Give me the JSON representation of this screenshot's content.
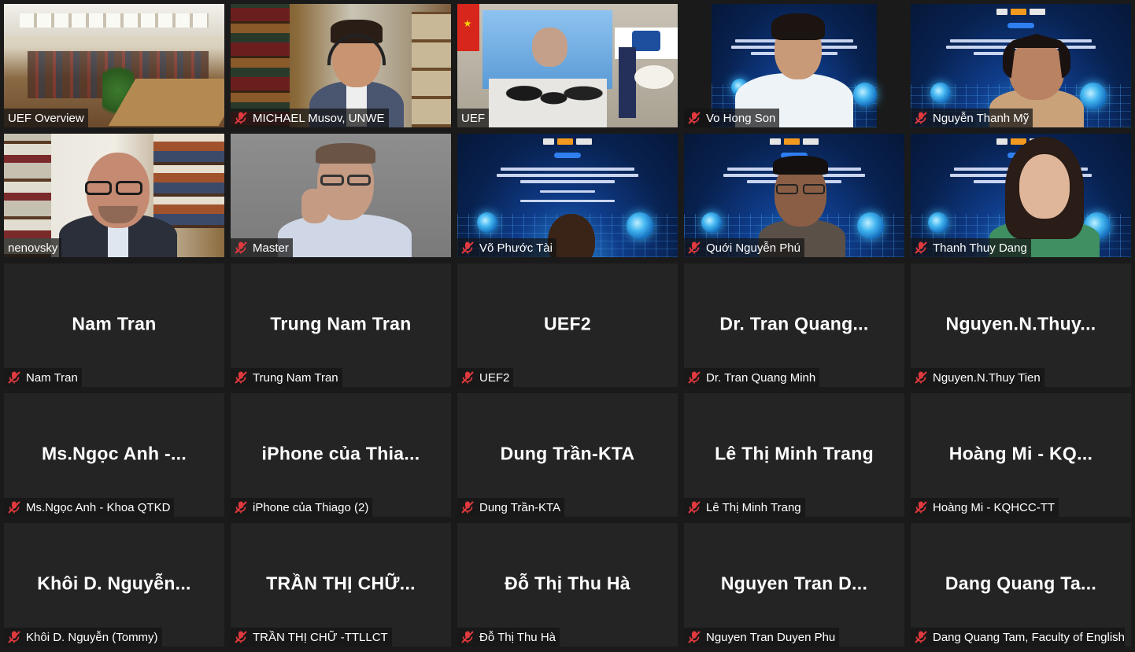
{
  "colors": {
    "background": "#1a1a1a",
    "tile": "#242424",
    "active_speaker_border": "#d8e25a",
    "muted_icon": "#e0393e"
  },
  "tiles": [
    {
      "name": "UEF Overview",
      "muted": false,
      "video": "room"
    },
    {
      "name": "MICHAEL Musov, UNWE",
      "muted": true,
      "video": "bookshelf-man"
    },
    {
      "name": "UEF",
      "muted": false,
      "video": "stage",
      "active": true
    },
    {
      "name": "Vo Hong Son",
      "muted": true,
      "video": "workshop-young-man"
    },
    {
      "name": "Nguyễn Thanh Mỹ",
      "muted": true,
      "video": "workshop-woman"
    },
    {
      "name": "nenovsky",
      "muted": false,
      "video": "library-man"
    },
    {
      "name": "Master",
      "muted": true,
      "video": "headset-man"
    },
    {
      "name": "Võ Phước Tài",
      "muted": true,
      "video": "workshop-bottom-head"
    },
    {
      "name": "Quới Nguyễn Phú",
      "muted": true,
      "video": "workshop-glasses-man"
    },
    {
      "name": "Thanh Thuy Dang",
      "muted": true,
      "video": "workshop-young-woman"
    },
    {
      "name": "Nam Tran",
      "display": "Nam Tran",
      "muted": true
    },
    {
      "name": "Trung Nam Tran",
      "display": "Trung Nam Tran",
      "muted": true
    },
    {
      "name": "UEF2",
      "display": "UEF2",
      "muted": true
    },
    {
      "name": "Dr. Tran Quang Minh",
      "display": "Dr. Tran Quang...",
      "muted": true
    },
    {
      "name": "Nguyen.N.Thuy Tien",
      "display": "Nguyen.N.Thuy...",
      "muted": true
    },
    {
      "name": "Ms.Ngọc Anh - Khoa QTKD",
      "display": "Ms.Ngọc Anh -...",
      "muted": true
    },
    {
      "name": "iPhone của Thiago (2)",
      "display": "iPhone của Thia...",
      "muted": true
    },
    {
      "name": "Dung Trần-KTA",
      "display": "Dung Trần-KTA",
      "muted": true
    },
    {
      "name": "Lê Thị Minh Trang",
      "display": "Lê Thị Minh Trang",
      "muted": true
    },
    {
      "name": "Hoàng Mi - KQHCC-TT",
      "display": "Hoàng Mi - KQ...",
      "muted": true
    },
    {
      "name": "Khôi D. Nguyễn (Tommy)",
      "display": "Khôi D. Nguyễn...",
      "muted": true
    },
    {
      "name": "TRẦN THỊ CHỮ -TTLLCT",
      "display": "TRẦN THỊ CHỮ...",
      "muted": true
    },
    {
      "name": "Đỗ Thị Thu Hà",
      "display": "Đỗ Thị Thu Hà",
      "muted": true
    },
    {
      "name": "Nguyen Tran Duyen Phu",
      "display": "Nguyen Tran D...",
      "muted": true
    },
    {
      "name": "Dang Quang Tam, Faculty of English",
      "display": "Dang Quang Ta...",
      "muted": true
    }
  ]
}
